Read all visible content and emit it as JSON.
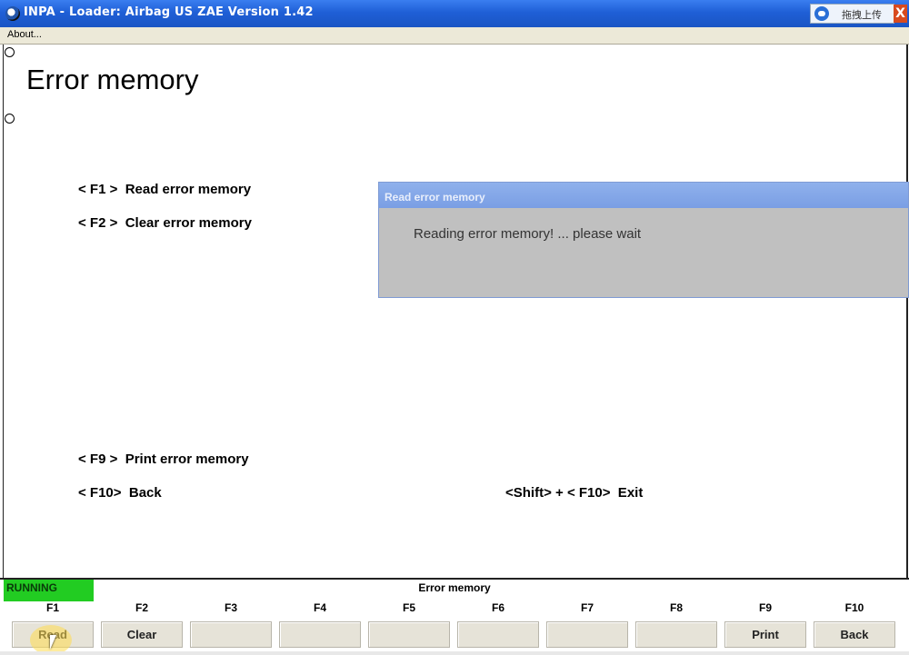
{
  "window": {
    "title": "INPA - Loader:  Airbag US ZAE Version 1.42",
    "upload_label": "拖拽上传",
    "close_label": "X"
  },
  "menu": {
    "about": "About..."
  },
  "page": {
    "heading": "Error memory",
    "lines": {
      "f1": "< F1 >  Read error memory",
      "f2": "< F2 >  Clear error memory",
      "f9": "< F9 >  Print error memory",
      "f10": "< F10>  Back",
      "exit": "<Shift> + < F10>  Exit"
    }
  },
  "dialog": {
    "title": "Read error memory",
    "message": "Reading error memory! ... please wait"
  },
  "status": {
    "state": "RUNNING",
    "title": "Error memory",
    "state_color": "#22cc22"
  },
  "fkeys": [
    {
      "key": "F1",
      "label": "Read"
    },
    {
      "key": "F2",
      "label": "Clear"
    },
    {
      "key": "F3",
      "label": ""
    },
    {
      "key": "F4",
      "label": ""
    },
    {
      "key": "F5",
      "label": ""
    },
    {
      "key": "F6",
      "label": ""
    },
    {
      "key": "F7",
      "label": ""
    },
    {
      "key": "F8",
      "label": ""
    },
    {
      "key": "F9",
      "label": "Print"
    },
    {
      "key": "F10",
      "label": "Back"
    }
  ]
}
